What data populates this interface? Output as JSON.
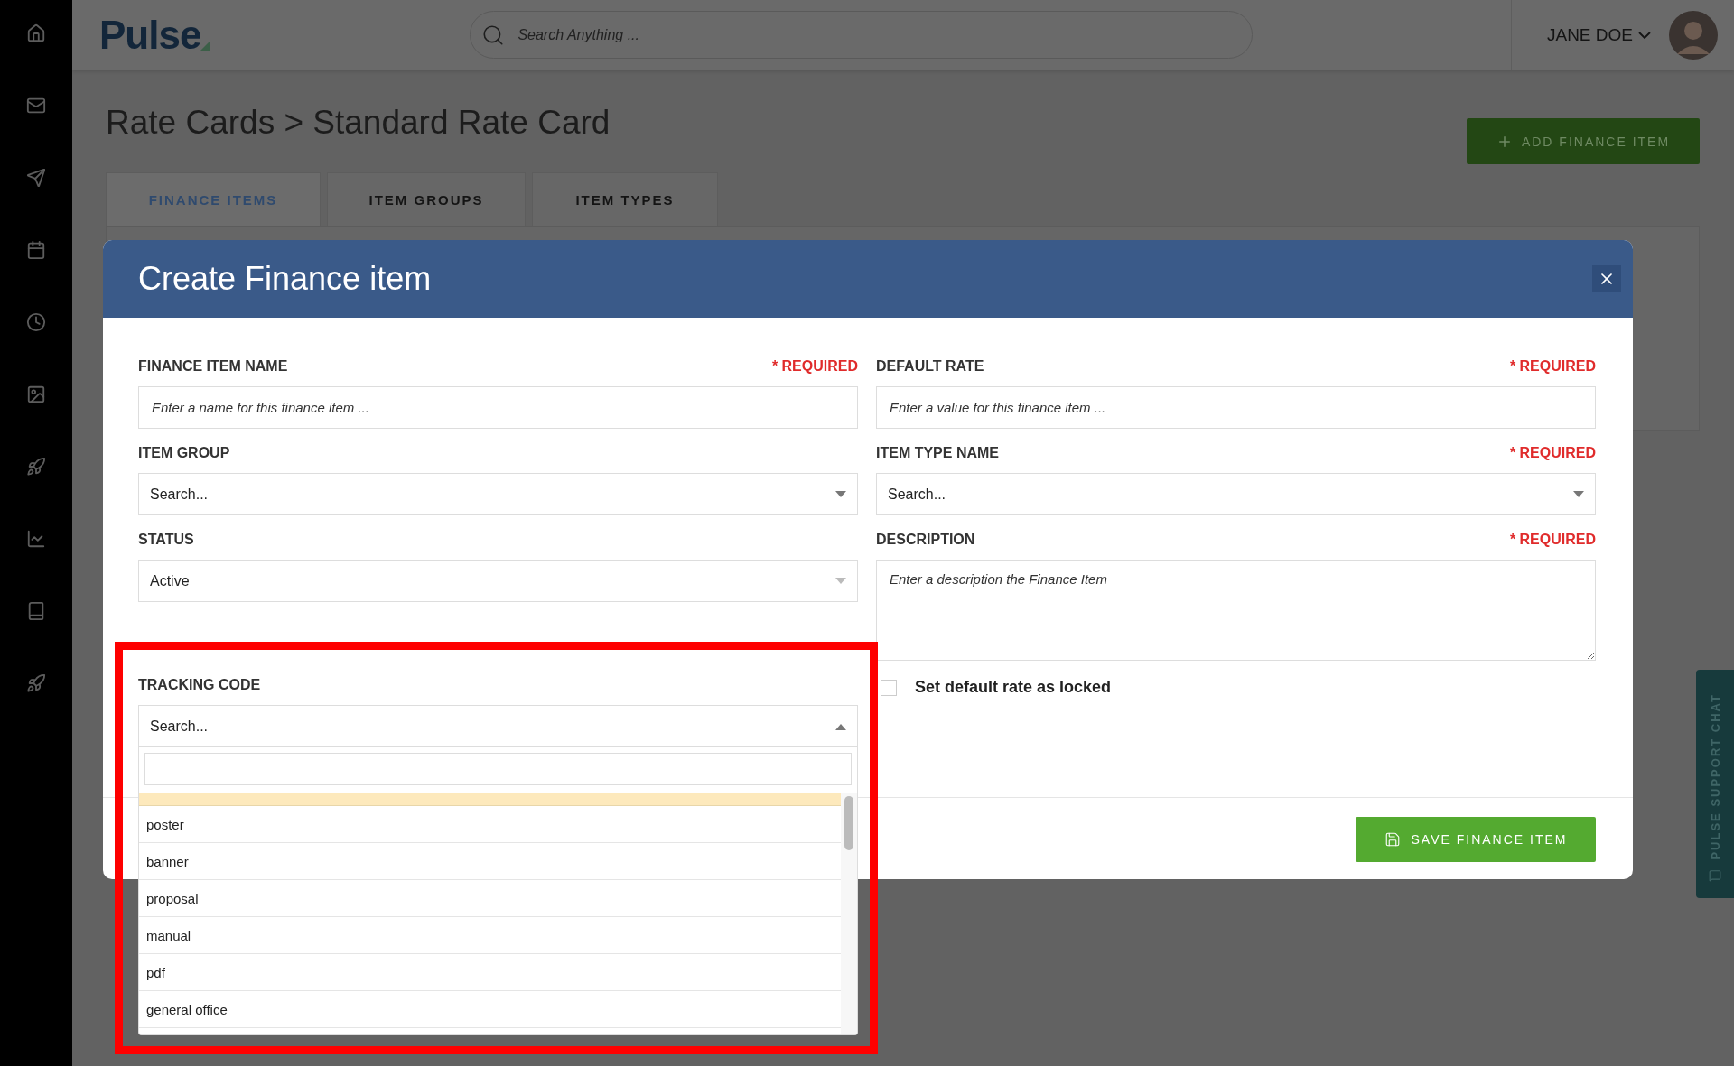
{
  "topbar": {
    "logo": "Pulse",
    "search": {
      "placeholder": "Search Anything ..."
    },
    "user": "JANE DOE"
  },
  "page": {
    "title": "Rate Cards > Standard Rate Card",
    "add_button": "ADD FINANCE ITEM",
    "tabs": [
      {
        "label": "FINANCE ITEMS",
        "selected": true
      },
      {
        "label": "ITEM GROUPS",
        "selected": false
      },
      {
        "label": "ITEM TYPES",
        "selected": false
      }
    ]
  },
  "modal": {
    "title": "Create Finance item",
    "left_fields": [
      {
        "kind": "text",
        "label": "FINANCE ITEM NAME",
        "required": "* REQUIRED",
        "placeholder": "Enter a name for this finance item ..."
      },
      {
        "kind": "select",
        "label": "ITEM GROUP",
        "value": "Search..."
      },
      {
        "kind": "select",
        "label": "STATUS",
        "value": "Active"
      }
    ],
    "right_fields": [
      {
        "kind": "text",
        "label": "DEFAULT RATE",
        "required": "* REQUIRED",
        "placeholder": "Enter a value for this finance item ..."
      },
      {
        "kind": "select",
        "label": "ITEM TYPE NAME",
        "required": "* REQUIRED",
        "value": "Search..."
      },
      {
        "kind": "textarea",
        "label": "DESCRIPTION",
        "required": "* REQUIRED",
        "placeholder": "Enter a description the Finance Item"
      }
    ],
    "checkbox": {
      "label": "Set default rate as locked",
      "checked": false
    },
    "tracking": {
      "label": "TRACKING CODE",
      "value": "Search...",
      "expanded": true,
      "highlighted_row": true,
      "options": [
        {
          "label": "poster"
        },
        {
          "label": "banner"
        },
        {
          "label": "proposal"
        },
        {
          "label": "manual"
        },
        {
          "label": "pdf"
        },
        {
          "label": "general office"
        }
      ]
    },
    "save_button": "SAVE FINANCE ITEM"
  },
  "support_chat": "PULSE SUPPORT CHAT"
}
